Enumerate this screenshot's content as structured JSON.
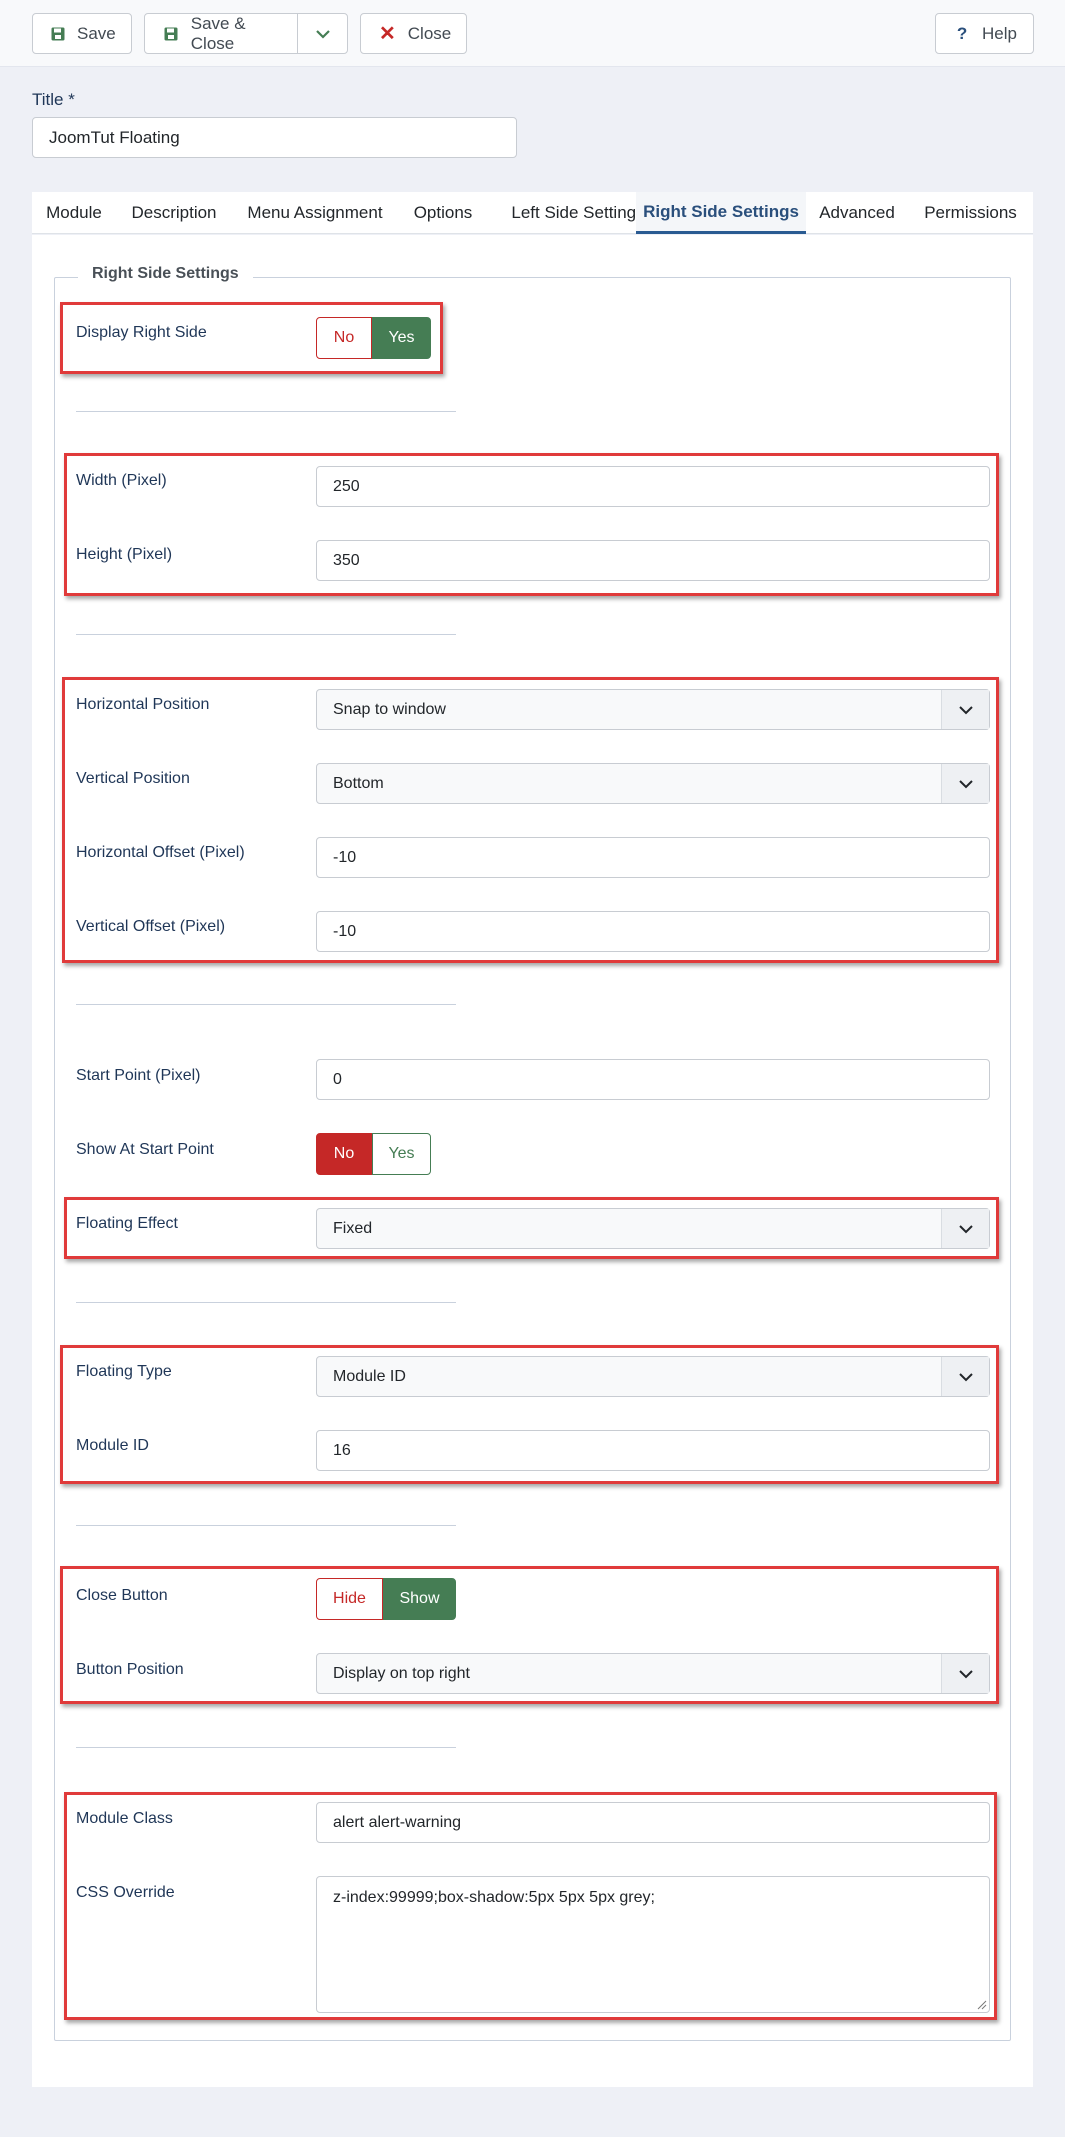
{
  "toolbar": {
    "save_label": "Save",
    "save_close_label": "Save & Close",
    "close_label": "Close",
    "help_label": "Help"
  },
  "title_field": {
    "label": "Title *",
    "value": "JoomTut Floating"
  },
  "tabs": [
    {
      "label": "Module"
    },
    {
      "label": "Description"
    },
    {
      "label": "Menu Assignment"
    },
    {
      "label": "Options"
    },
    {
      "label": "Left Side Settings"
    },
    {
      "label": "Right Side Settings",
      "active": true
    },
    {
      "label": "Advanced"
    },
    {
      "label": "Permissions"
    }
  ],
  "fieldset": {
    "legend": "Right Side Settings",
    "display_right_side": {
      "label": "Display Right Side",
      "options": [
        "No",
        "Yes"
      ],
      "selected": "Yes"
    },
    "width": {
      "label": "Width (Pixel)",
      "value": "250"
    },
    "height": {
      "label": "Height (Pixel)",
      "value": "350"
    },
    "horizontal_position": {
      "label": "Horizontal Position",
      "value": "Snap to window"
    },
    "vertical_position": {
      "label": "Vertical Position",
      "value": "Bottom"
    },
    "horizontal_offset": {
      "label": "Horizontal Offset (Pixel)",
      "value": "-10"
    },
    "vertical_offset": {
      "label": "Vertical Offset (Pixel)",
      "value": "-10"
    },
    "start_point": {
      "label": "Start Point (Pixel)",
      "value": "0"
    },
    "show_at_start_point": {
      "label": "Show At Start Point",
      "options": [
        "No",
        "Yes"
      ],
      "selected": "No"
    },
    "floating_effect": {
      "label": "Floating Effect",
      "value": "Fixed"
    },
    "floating_type": {
      "label": "Floating Type",
      "value": "Module ID"
    },
    "module_id": {
      "label": "Module ID",
      "value": "16"
    },
    "close_button": {
      "label": "Close Button",
      "options": [
        "Hide",
        "Show"
      ],
      "selected": "Show"
    },
    "button_position": {
      "label": "Button Position",
      "value": "Display on top right"
    },
    "module_class": {
      "label": "Module Class",
      "value": "alert alert-warning"
    },
    "css_override": {
      "label": "CSS Override",
      "value": "z-index:99999;box-shadow:5px 5px 5px grey;"
    }
  },
  "colors": {
    "highlight_box": "#e03a3a",
    "active_green": "#457d54",
    "active_red": "#c52827",
    "accent_blue": "#2a4f7c"
  }
}
